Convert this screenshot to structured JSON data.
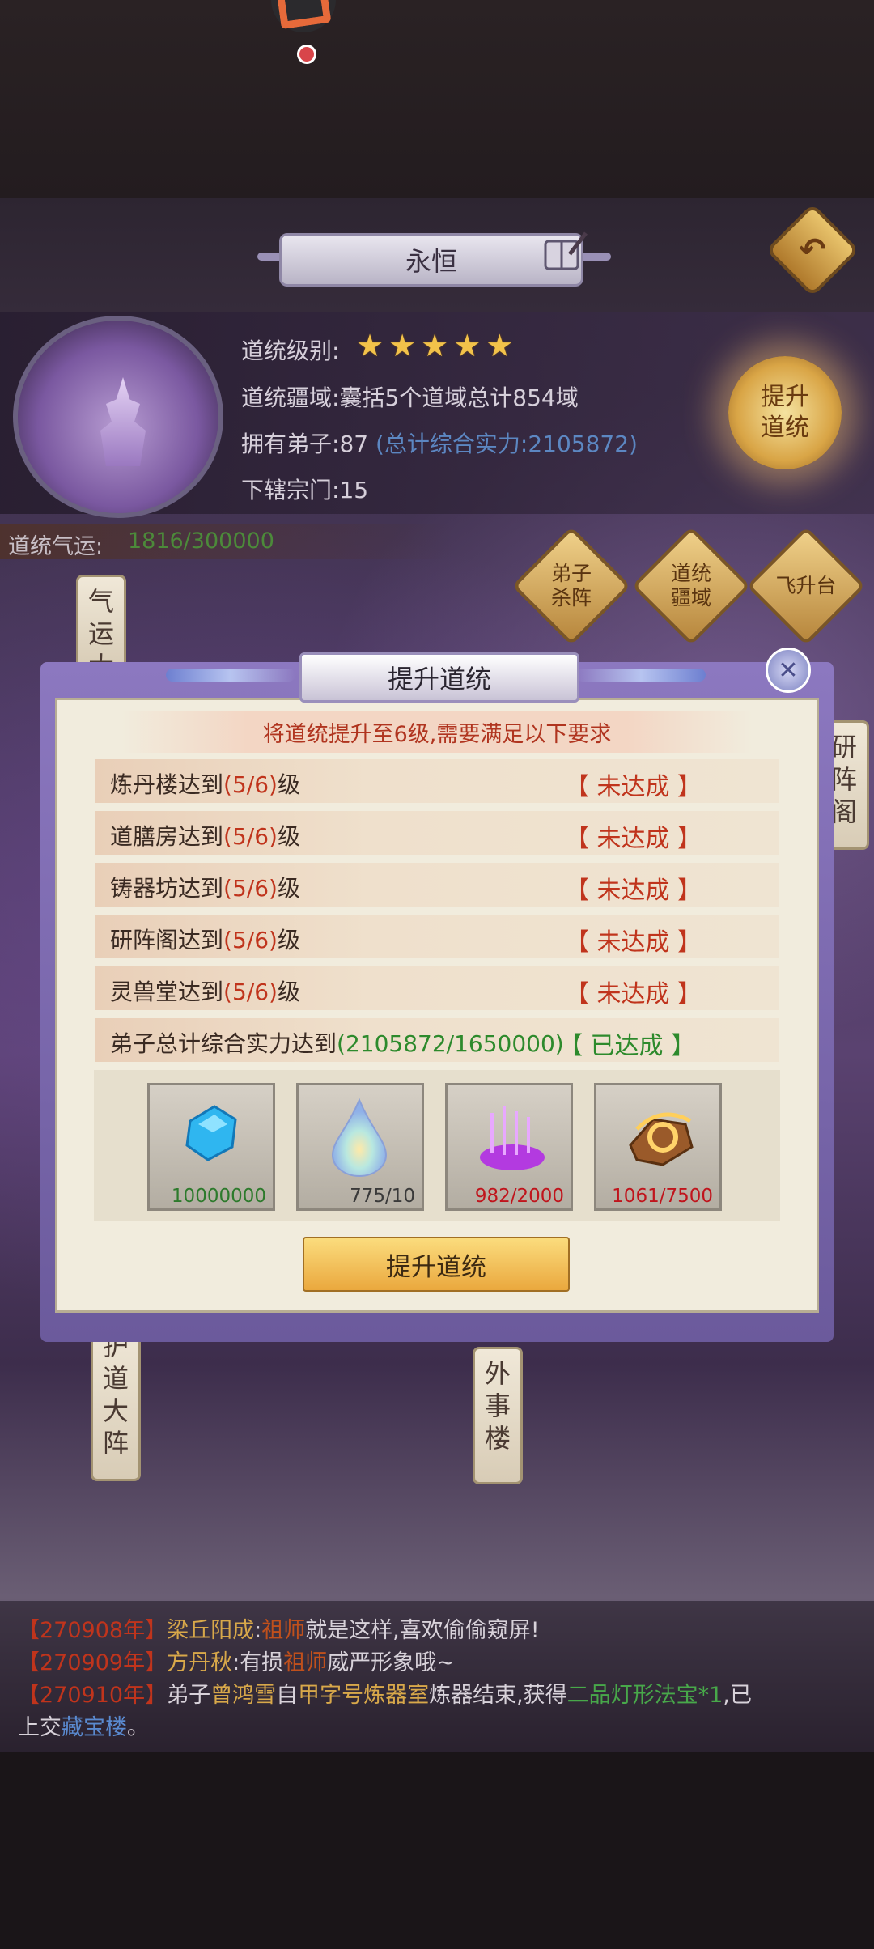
{
  "header": {
    "title": "永恒",
    "back_icon": "back-arrow-icon"
  },
  "info": {
    "level_label": "道统级别:",
    "star_count": 5,
    "territory_label": "道统疆域:",
    "territory_value": "囊括5个道域总计854域",
    "disciples_label": "拥有弟子:",
    "disciples_value": "87",
    "disciples_power": "(总计综合实力:2105872)",
    "sects_label": "下辖宗门:",
    "sects_value": "15",
    "raise_button": "提升道统",
    "luck_label": "道统气运:",
    "luck_value": "1816/300000"
  },
  "scene": {
    "btn_disciple_array": "弟子杀阵",
    "btn_territory": "道统疆域",
    "btn_ascend": "飞升台",
    "banner_qi": "气运大",
    "banner_yanzhen": "研阵阁",
    "banner_hudao": "护道大阵",
    "banner_waishi": "外事楼"
  },
  "modal": {
    "title": "提升道统",
    "requirement_header": "将道统提升至6级,需要满足以下要求",
    "requirements": [
      {
        "prefix": "炼丹楼达到",
        "value": "(5/6)",
        "suffix": "级",
        "status": "【 未达成 】",
        "met": false
      },
      {
        "prefix": "道膳房达到",
        "value": "(5/6)",
        "suffix": "级",
        "status": "【 未达成 】",
        "met": false
      },
      {
        "prefix": "铸器坊达到",
        "value": "(5/6)",
        "suffix": "级",
        "status": "【 未达成 】",
        "met": false
      },
      {
        "prefix": "研阵阁达到",
        "value": "(5/6)",
        "suffix": "级",
        "status": "【 未达成 】",
        "met": false
      },
      {
        "prefix": "灵兽堂达到",
        "value": "(5/6)",
        "suffix": "级",
        "status": "【 未达成 】",
        "met": false
      },
      {
        "prefix": "弟子总计综合实力达到",
        "value": "(2105872/1650000)",
        "suffix": "",
        "status": "【 已达成 】",
        "met": true
      }
    ],
    "items": [
      {
        "icon": "blue-spirit-stone-icon",
        "count": "10000000",
        "color": "#2d7a2c"
      },
      {
        "icon": "rainbow-droplet-icon",
        "count": "775/10",
        "color": "#3a3a3a"
      },
      {
        "icon": "purple-aura-icon",
        "count": "982/2000",
        "color": "#c0141c"
      },
      {
        "icon": "golden-ore-icon",
        "count": "1061/7500",
        "color": "#c0141c"
      }
    ],
    "confirm_button": "提升道统"
  },
  "chat": {
    "lines": [
      {
        "time": "【270908年】",
        "name": "梁丘阳成",
        "sep": ":",
        "hl": "祖师",
        "rest": "就是这样,喜欢偷偷窥屏!"
      },
      {
        "time": "【270909年】",
        "name": "方丹秋",
        "sep": ":",
        "pre": "有损",
        "hl": "祖师",
        "rest": "威严形象哦~"
      },
      {
        "time": "【270910年】",
        "pre": "弟子",
        "name": "曾鸿雪",
        "mid": "自",
        "place": "甲字号炼器室",
        "mid2": "炼器结束,获得",
        "item": "二品灯形法宝*1",
        "rest": ",已"
      },
      {
        "cont": "上交",
        "place": "藏宝楼",
        "rest": "。"
      }
    ]
  },
  "colors": {
    "gold": "#f2c24a",
    "fail_red": "#c0341c",
    "success_green": "#2d8a2c",
    "power_blue": "#5c87c2"
  }
}
